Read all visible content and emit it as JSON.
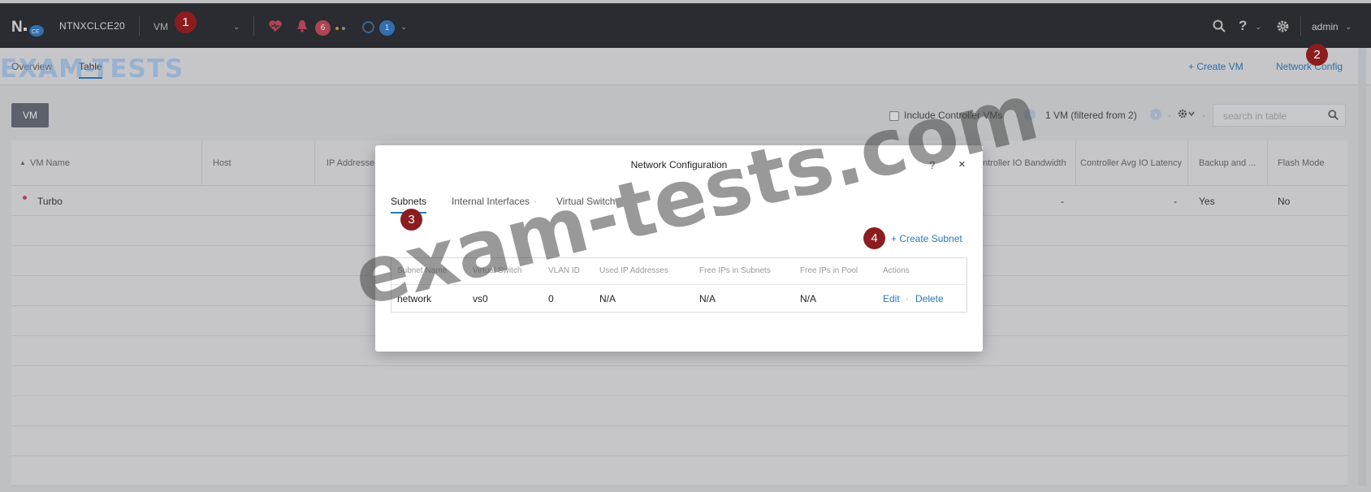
{
  "topbar": {
    "cluster_name": "NTNXCLCE20",
    "entity_menu": "VM",
    "alert_count": "6",
    "task_count": "1",
    "user": "admin",
    "logo_badge": "CE"
  },
  "subnav": {
    "tabs": [
      {
        "label": "Overview"
      },
      {
        "label": "Table"
      }
    ],
    "actions": {
      "create_vm": "+ Create VM",
      "network_config": "Network Config"
    }
  },
  "toolbar": {
    "vm_button": "VM",
    "include_controller": "Include Controller VMs",
    "filter_text": "1 VM (filtered from 2)",
    "search_placeholder": "search in table"
  },
  "table": {
    "columns": [
      "VM Name",
      "Host",
      "IP Addresse...",
      "ntroller IO Bandwidth",
      "Controller Avg IO Latency",
      "Backup and ...",
      "Flash Mode"
    ],
    "row": {
      "name": "Turbo",
      "bandwidth": "-",
      "latency": "-",
      "backup": "Yes",
      "flash": "No"
    }
  },
  "modal": {
    "title": "Network Configuration",
    "help": "?",
    "close": "×",
    "tabs": [
      {
        "label": "Subnets"
      },
      {
        "label": "Internal Interfaces"
      },
      {
        "label": "Virtual Switch"
      }
    ],
    "create_subnet": "+ Create Subnet",
    "columns": [
      "Subnet Name",
      "Virtual Switch",
      "VLAN ID",
      "Used IP Addresses",
      "Free IPs in Subnets",
      "Free IPs in Pool",
      "Actions"
    ],
    "rows": [
      {
        "name": "network",
        "switch": "vs0",
        "vlan": "0",
        "used": "N/A",
        "free_subnet": "N/A",
        "free_pool": "N/A",
        "edit": "Edit",
        "sep": "·",
        "delete": "Delete"
      }
    ]
  },
  "badges": [
    "1",
    "2",
    "3",
    "4"
  ],
  "watermark": {
    "logo": "EXAM-TESTS",
    "big": "exam-tests.com"
  }
}
